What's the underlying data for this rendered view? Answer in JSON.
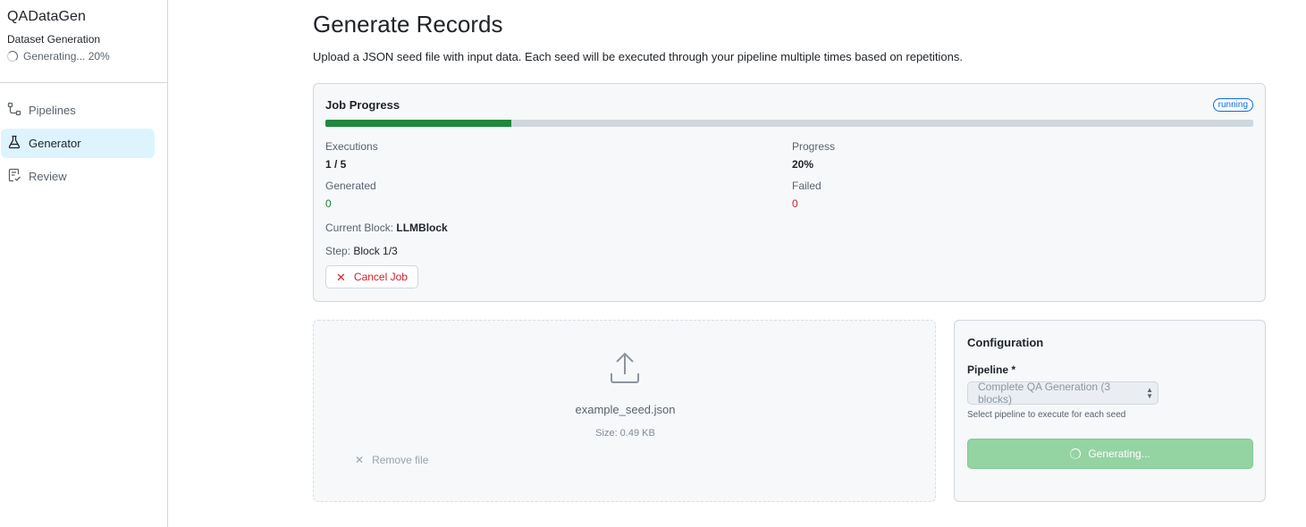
{
  "app": {
    "title": "QADataGen",
    "subtitle": "Dataset Generation",
    "status": "Generating... 20%"
  },
  "nav": {
    "items": [
      {
        "label": "Pipelines",
        "icon": "pipeline-icon"
      },
      {
        "label": "Generator",
        "icon": "beaker-icon",
        "active": true
      },
      {
        "label": "Review",
        "icon": "review-checklist-icon"
      }
    ]
  },
  "page": {
    "title": "Generate Records",
    "description": "Upload a JSON seed file with input data. Each seed will be executed through your pipeline multiple times based on repetitions."
  },
  "job": {
    "heading": "Job Progress",
    "status_badge": "running",
    "progress_fraction": 0.2,
    "executions_label": "Executions",
    "executions_value": "1 / 5",
    "progress_label": "Progress",
    "progress_value": "20%",
    "generated_label": "Generated",
    "generated_value": "0",
    "failed_label": "Failed",
    "failed_value": "0",
    "current_block_label": "Current Block:",
    "current_block_value": "LLMBlock",
    "step_label": "Step:",
    "step_value": "Block 1/3",
    "cancel_label": "Cancel Job"
  },
  "upload": {
    "file_name": "example_seed.json",
    "file_size": "Size: 0.49 KB",
    "remove_label": "Remove file"
  },
  "config": {
    "title": "Configuration",
    "pipeline_label": "Pipeline *",
    "pipeline_selected": "Complete QA Generation (3 blocks)",
    "pipeline_help": "Select pipeline to execute for each seed",
    "generate_label": "Generating..."
  },
  "colors": {
    "accent": "#0969da",
    "success": "#1f883d",
    "danger": "#cf222e",
    "active_nav_bg": "#ddf4ff",
    "disabled_button": "#94d3a2"
  }
}
